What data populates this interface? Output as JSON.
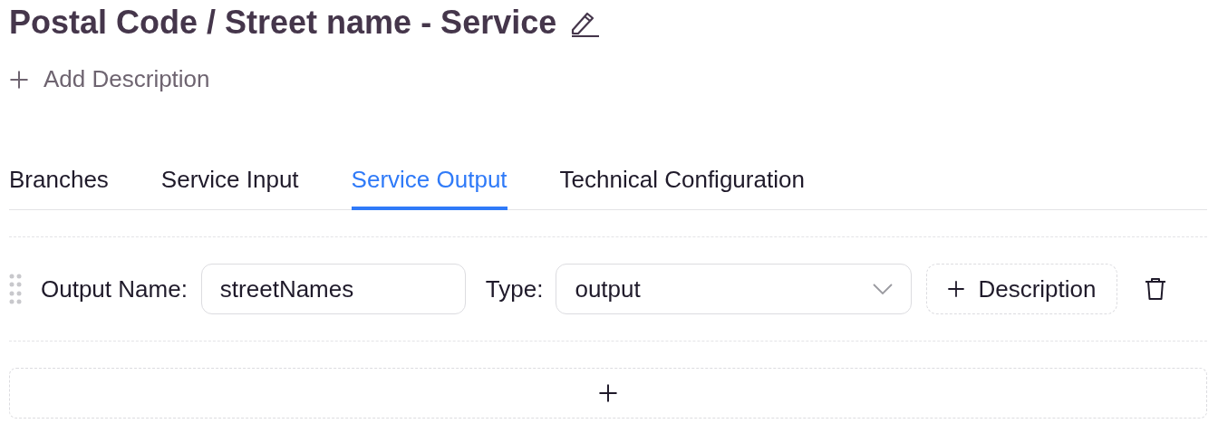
{
  "title": "Postal Code / Street name - Service",
  "add_description": "Add Description",
  "tabs": [
    {
      "label": "Branches",
      "selected": false
    },
    {
      "label": "Service Input",
      "selected": false
    },
    {
      "label": "Service Output",
      "selected": true
    },
    {
      "label": "Technical Configuration",
      "selected": false
    }
  ],
  "outputs": [
    {
      "name_label": "Output Name:",
      "name_value": "streetNames",
      "type_label": "Type:",
      "type_value": "output",
      "description_button": "Description"
    }
  ]
}
